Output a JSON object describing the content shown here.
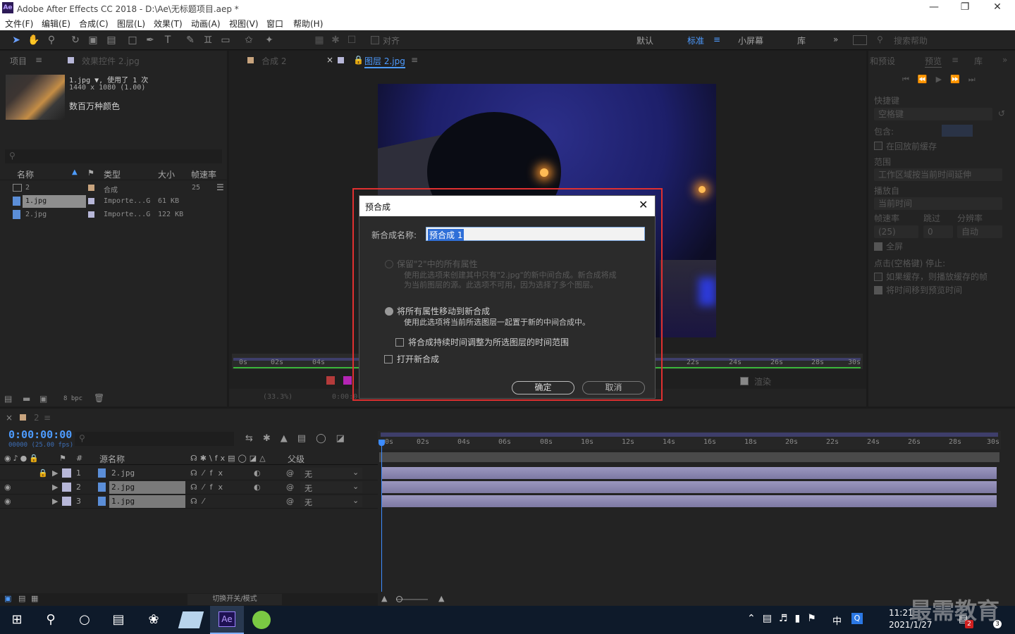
{
  "window": {
    "title": "Adobe After Effects CC 2018 - D:\\Ae\\无标题项目.aep *",
    "app_icon": "Ae"
  },
  "menu": [
    "文件(F)",
    "编辑(E)",
    "合成(C)",
    "图层(L)",
    "效果(T)",
    "动画(A)",
    "视图(V)",
    "窗口",
    "帮助(H)"
  ],
  "toolbar": {
    "align_label": "对齐",
    "workspaces": [
      "默认",
      "标准",
      "小屏幕",
      "库"
    ],
    "active_workspace": "标准",
    "search_placeholder": "搜索帮助"
  },
  "project_panel": {
    "tabs": [
      "项目",
      "效果控件 2.jpg"
    ],
    "selected_name": "1.jpg ▼, 使用了 1 次",
    "selected_dims": "1440 x 1080 (1.00)",
    "selected_colors": "数百万种颜色",
    "search_placeholder": "",
    "columns": [
      "名称",
      "类型",
      "大小",
      "帧速率"
    ],
    "items": [
      {
        "name": "2",
        "type": "合成",
        "size": "",
        "fps": "25"
      },
      {
        "name": "1.jpg",
        "type": "Importe...G",
        "size": "61 KB",
        "fps": ""
      },
      {
        "name": "2.jpg",
        "type": "Importe...G",
        "size": "122 KB",
        "fps": ""
      }
    ],
    "bpc": "8 bpc"
  },
  "viewer": {
    "tabs": [
      "合成 2",
      "图层 2.jpg"
    ],
    "ruler_ticks": [
      "0s",
      "02s",
      "04s",
      "22s",
      "24s",
      "26s",
      "28s",
      "30s"
    ],
    "zoom": "(33.3%)",
    "timecode": "0:00:0",
    "render_label": "渲染"
  },
  "preview_panel": {
    "tabs": [
      "和预设",
      "预览",
      "库"
    ],
    "shortcut_label": "快捷键",
    "shortcut_value": "空格键",
    "include_label": "包含:",
    "cache_label": "在回放前缓存",
    "range_label": "范围",
    "range_value": "工作区域按当前时间延伸",
    "play_from_label": "播放自",
    "play_from_value": "当前时间",
    "fps_label": "帧速率",
    "skip_label": "跳过",
    "res_label": "分辨率",
    "fps_value": "(25)",
    "skip_value": "0",
    "res_value": "自动",
    "fullscreen_label": "全屏",
    "stop_label": "点击(空格键) 停止:",
    "if_cache_label": "如果缓存，则播放缓存的帧",
    "move_time_label": "将时间移到预览时间"
  },
  "timeline": {
    "comp_tab": "2",
    "timecode": "0:00:00:00",
    "frames": "00000 (25.00 fps)",
    "col_source": "源名称",
    "col_parent": "父级",
    "ruler": [
      "0s",
      "02s",
      "04s",
      "06s",
      "08s",
      "10s",
      "12s",
      "14s",
      "16s",
      "18s",
      "20s",
      "22s",
      "24s",
      "26s",
      "28s",
      "30s"
    ],
    "layers": [
      {
        "num": "1",
        "name": "2.jpg",
        "parent": "无"
      },
      {
        "num": "2",
        "name": "2.jpg",
        "parent": "无"
      },
      {
        "num": "3",
        "name": "1.jpg",
        "parent": "无"
      }
    ],
    "toggle_label": "切换开关/模式"
  },
  "dialog": {
    "title": "预合成",
    "name_label": "新合成名称:",
    "name_value": "预合成 1",
    "opt1_label": "保留\"2\"中的所有属性",
    "opt1_desc1": "使用此选项来创建其中只有\"2.jpg\"的新中间合成。新合成将成",
    "opt1_desc2": "为当前图层的源。此选项不可用，因为选择了多个图层。",
    "opt2_label": "将所有属性移动到新合成",
    "opt2_desc": "使用此选项将当前所选图层一起置于新的中间合成中。",
    "adjust_label": "将合成持续时间调整为所选图层的时间范围",
    "open_label": "打开新合成",
    "ok": "确定",
    "cancel": "取消",
    "highlight_color": "#e03030"
  },
  "taskbar": {
    "time": "11:21",
    "date": "2021/1/27",
    "ime": "中",
    "watermark": "最需教育",
    "notif_count": "2",
    "notif_count2": "3"
  }
}
